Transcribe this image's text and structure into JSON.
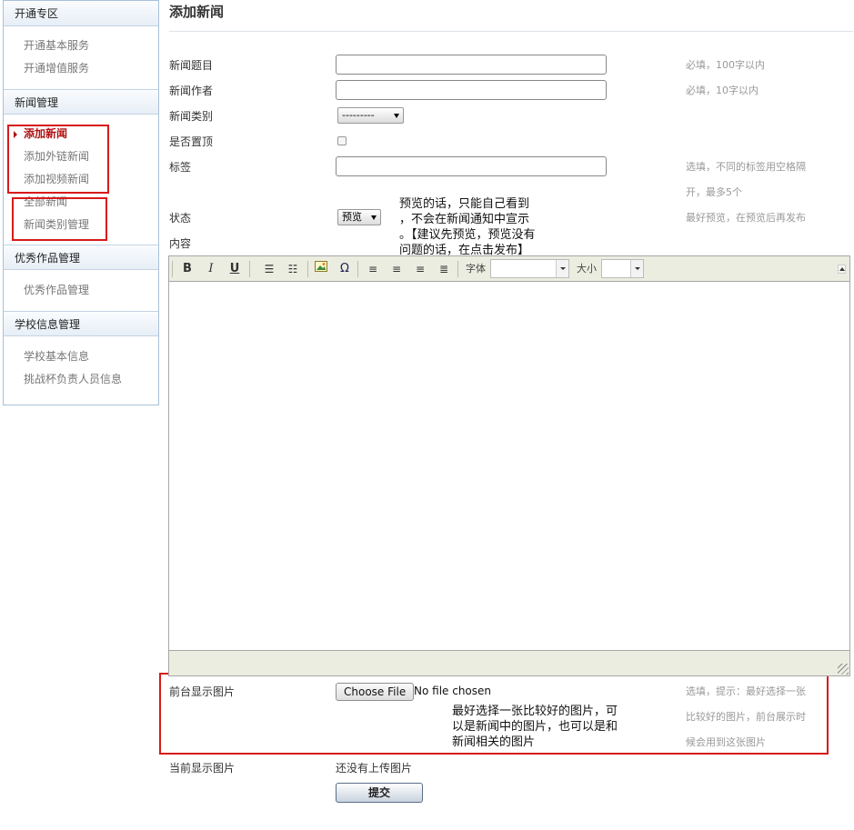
{
  "sidebar": {
    "sections": [
      {
        "title": "开通专区",
        "items": [
          "开通基本服务",
          "开通增值服务"
        ]
      },
      {
        "title": "新闻管理",
        "items": [
          "添加新闻",
          "添加外链新闻",
          "添加视频新闻",
          "全部新闻",
          "新闻类别管理"
        ],
        "active_index": 0
      },
      {
        "title": "优秀作品管理",
        "items": [
          "优秀作品管理"
        ]
      },
      {
        "title": "学校信息管理",
        "items": [
          "学校基本信息",
          "挑战杯负责人员信息"
        ]
      }
    ]
  },
  "page": {
    "title": "添加新闻"
  },
  "form": {
    "news_title": {
      "label": "新闻题目",
      "value": "",
      "hint": "必填，100字以内"
    },
    "news_author": {
      "label": "新闻作者",
      "value": "",
      "hint": "必填，10字以内"
    },
    "news_category": {
      "label": "新闻类别",
      "selected": "---------"
    },
    "pinned": {
      "label": "是否置顶",
      "checked": false
    },
    "tags": {
      "label": "标签",
      "value": "",
      "hint_line1": "选填，不同的标签用空格隔",
      "hint_line2": "开，最多5个"
    },
    "status": {
      "label": "状态",
      "selected": "预览",
      "hint": "最好预览，在预览后再发布"
    },
    "content": {
      "label": "内容"
    },
    "front_image": {
      "label": "前台显示图片",
      "button": "Choose File",
      "file_status": "No file chosen",
      "hint_line1": "选填，提示：最好选择一张",
      "hint_line2": "比较好的图片，前台展示时",
      "hint_line3": "候会用到这张图片"
    },
    "current_image": {
      "label": "当前显示图片",
      "value": "还没有上传图片"
    },
    "submit": {
      "label": "提交"
    }
  },
  "editor": {
    "font_label": "字体",
    "size_label": "大小",
    "font_value": "",
    "size_value": ""
  },
  "annotations": {
    "status_note": [
      "预览的话，只能自己看到",
      "，不会在新闻通知中宣示",
      "。【建议先预览，预览没有",
      "问题的话，在点击发布】"
    ],
    "image_note": [
      "最好选择一张比较好的图片，可",
      "以是新闻中的图片，也可以是和",
      "新闻相关的图片"
    ]
  },
  "colors": {
    "accent_red": "#d71a1a",
    "active_text": "#b01010",
    "hint_gray": "#999999",
    "toolbar_bg": "#ecede1"
  }
}
